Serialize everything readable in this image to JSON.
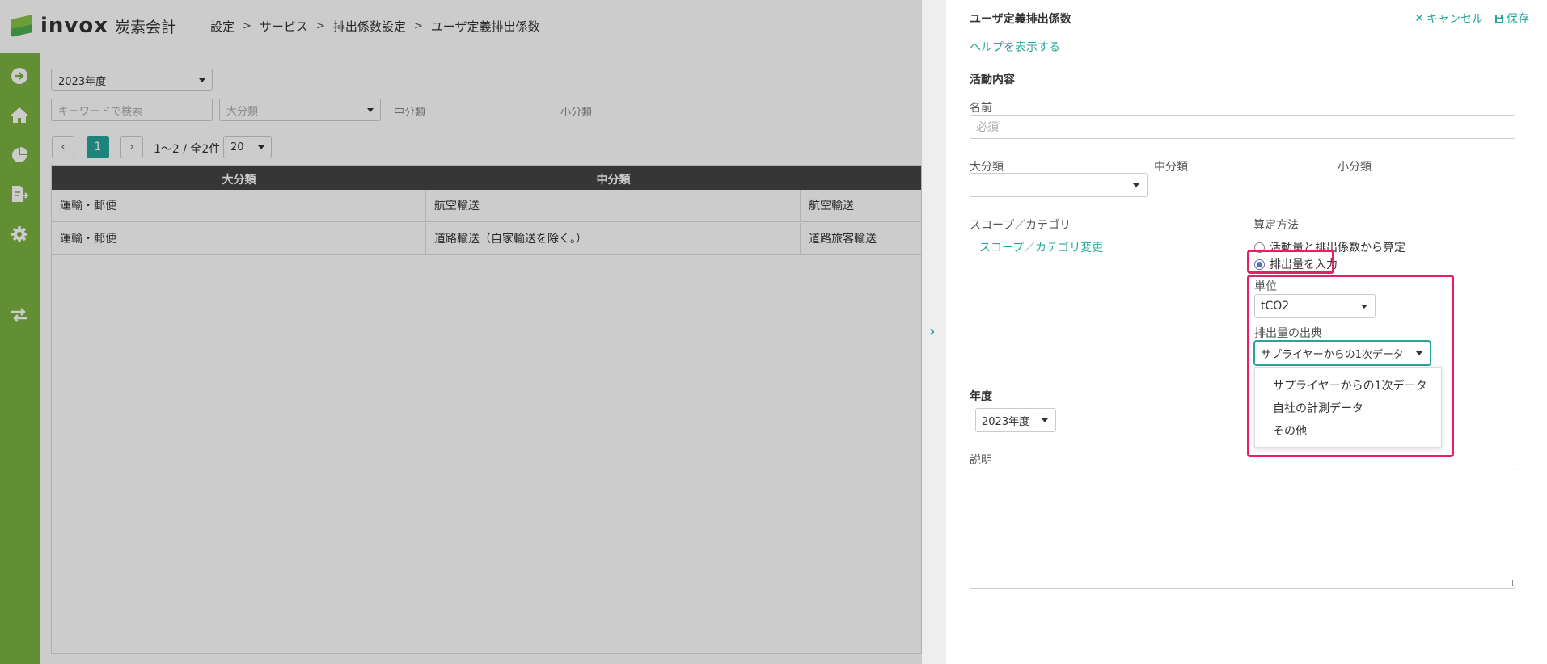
{
  "app": {
    "logo_text": "invox",
    "logo_sub": "炭素会計",
    "breadcrumb": [
      "設定",
      "サービス",
      "排出係数設定",
      "ユーザ定義排出係数"
    ]
  },
  "sidebar": {
    "icons": [
      "sign-in-icon",
      "home-icon",
      "pie-chart-icon",
      "file-export-icon",
      "gear-icon",
      "exchange-icon"
    ]
  },
  "filters": {
    "year": "2023年度",
    "keyword_placeholder": "キーワードで検索",
    "major_placeholder": "大分類",
    "middle_label": "中分類",
    "minor_label": "小分類"
  },
  "pager": {
    "prev": "‹",
    "current": "1",
    "next": "›",
    "info": "1〜2 / 全2件",
    "per_page": "20"
  },
  "table": {
    "headers": [
      "大分類",
      "中分類"
    ],
    "rows": [
      [
        "運輸・郵便",
        "航空輸送",
        "航空輸送"
      ],
      [
        "運輸・郵便",
        "道路輸送（自家輸送を除く。）",
        "道路旅客輸送"
      ]
    ]
  },
  "panel": {
    "title": "ユーザ定義排出係数",
    "cancel_label": "キャンセル",
    "save_label": "保存",
    "help_link": "ヘルプを表示する",
    "activity_section": "活動内容",
    "name_label": "名前",
    "name_placeholder": "必須",
    "major_label": "大分類",
    "middle_label": "中分類",
    "minor_label": "小分類",
    "scope_label": "スコープ／カテゴリ",
    "scope_link": "スコープ／カテゴリ変更",
    "method_label": "算定方法",
    "method_options": [
      "活動量と排出係数から算定",
      "排出量を入力"
    ],
    "unit_label": "単位",
    "unit_value": "tCO2",
    "source_label": "排出量の出典",
    "source_value": "サプライヤーからの1次データ",
    "source_options": [
      "サプライヤーからの1次データ",
      "自社の計測データ",
      "その他"
    ],
    "year_section": "年度",
    "year_value": "2023年度",
    "description_label": "説明"
  },
  "colors": {
    "accent": "#26a69a",
    "sidebar": "#7cb342",
    "highlight": "#e91e63"
  }
}
